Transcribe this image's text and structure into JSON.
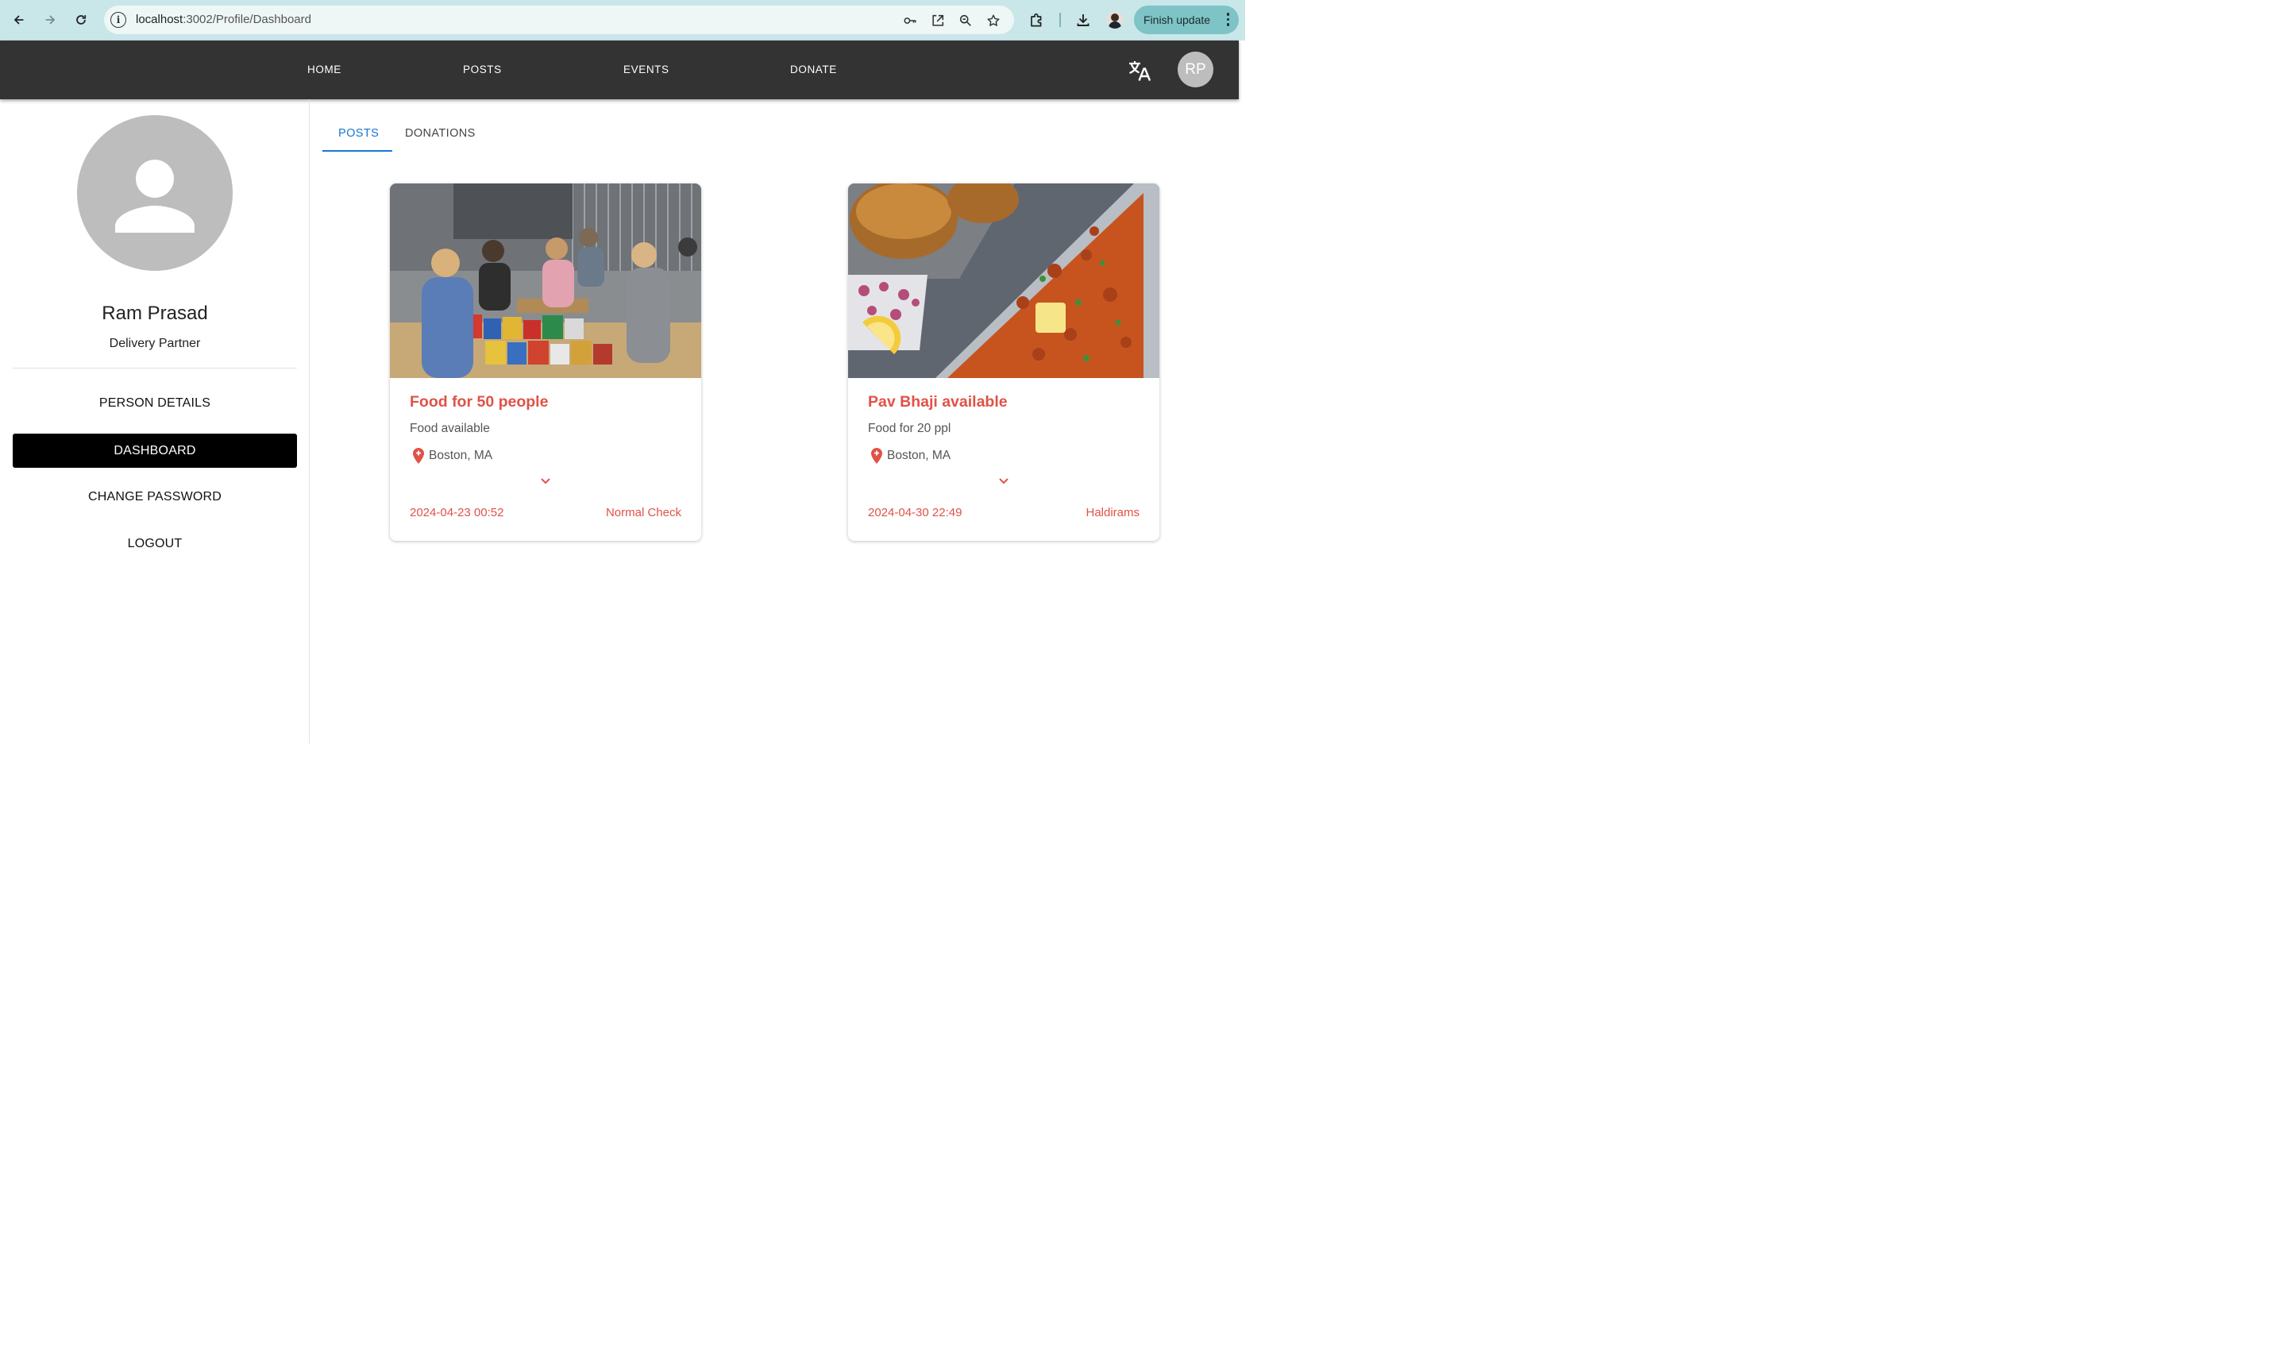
{
  "browser": {
    "url_host": "localhost",
    "url_path": ":3002/Profile/Dashboard",
    "finish_update_label": "Finish update",
    "icons": [
      "back-arrow-icon",
      "forward-arrow-icon",
      "reload-icon",
      "site-info-icon",
      "password-key-icon",
      "open-external-icon",
      "zoom-icon",
      "bookmark-star-icon",
      "extensions-icon",
      "download-icon",
      "profile-avatar-icon",
      "more-vert-icon"
    ]
  },
  "app_bar": {
    "nav": [
      "HOME",
      "POSTS",
      "EVENTS",
      "DONATE"
    ],
    "avatar_initials": "RP",
    "background": "#333333"
  },
  "sidebar": {
    "name": "Ram Prasad",
    "role": "Delivery Partner",
    "items": [
      {
        "label": "PERSON DETAILS",
        "active": false
      },
      {
        "label": "DASHBOARD",
        "active": true
      },
      {
        "label": "CHANGE PASSWORD",
        "active": false
      },
      {
        "label": "LOGOUT",
        "active": false
      }
    ]
  },
  "tabs": [
    {
      "label": "POSTS",
      "active": true
    },
    {
      "label": "DONATIONS",
      "active": false
    }
  ],
  "cards": [
    {
      "title": "Food for 50 people",
      "description": "Food available",
      "location": "Boston, MA",
      "date": "2024-04-23 00:52",
      "author": "Normal Check",
      "image": "volunteers sorting food donations in a warehouse"
    },
    {
      "title": "Pav Bhaji available",
      "description": "Food for 20 ppl",
      "location": "Boston, MA",
      "date": "2024-04-30 22:49",
      "author": "Haldirams",
      "image": "plate of pav bhaji with buns, onions and lemon"
    }
  ],
  "colors": {
    "accent_red": "#e05247",
    "tab_blue": "#1976d2",
    "browser_chrome": "#c9e6e8"
  }
}
